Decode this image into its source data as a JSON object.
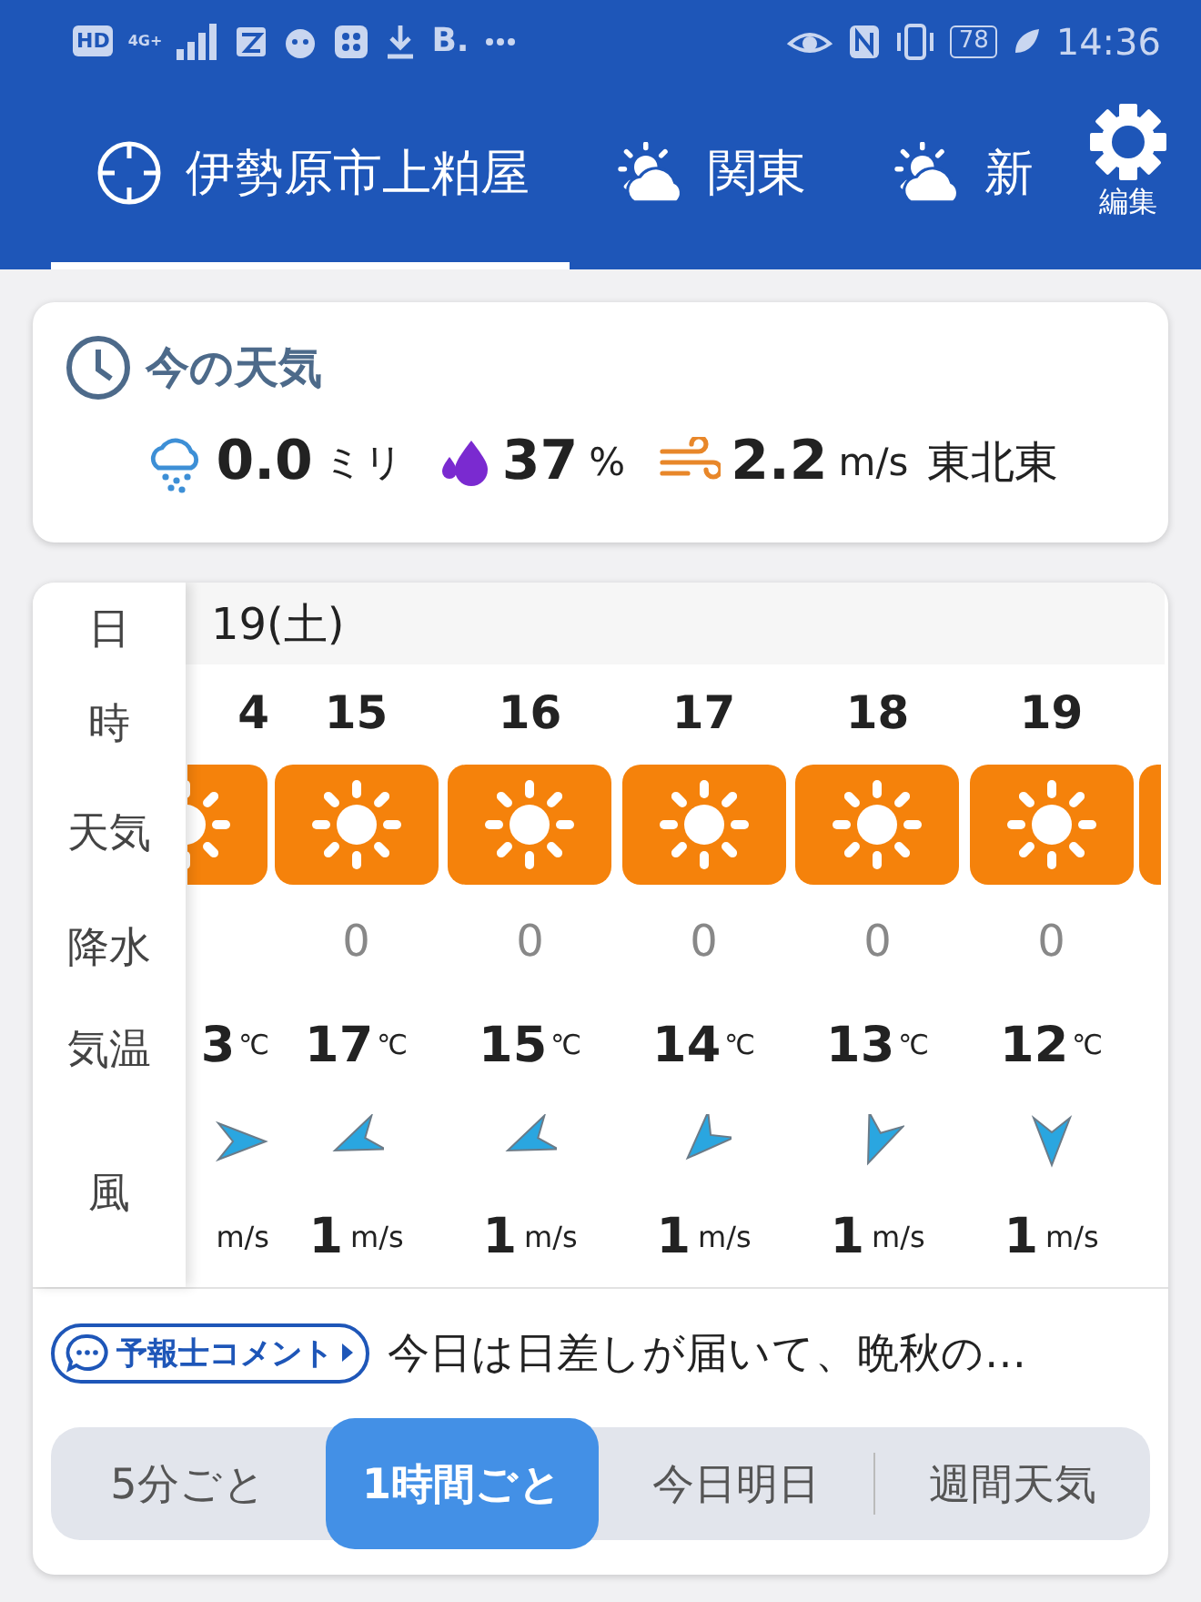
{
  "status_bar": {
    "hd": "HD",
    "network": "4G+",
    "app_letter": "B.",
    "battery": "78",
    "time": "14:36"
  },
  "tabs": [
    {
      "label": "伊勢原市上粕屋",
      "selected": true,
      "kind": "location"
    },
    {
      "label": "関東",
      "selected": false,
      "kind": "region"
    },
    {
      "label": "新",
      "selected": false,
      "kind": "region"
    }
  ],
  "edit_button": {
    "label": "編集"
  },
  "now": {
    "title": "今の天気",
    "rain": {
      "value": "0.0",
      "unit": "ミリ"
    },
    "humidity": {
      "value": "37",
      "unit": "%"
    },
    "wind": {
      "value": "2.2",
      "unit": "m/s",
      "direction": "東北東"
    }
  },
  "forecast": {
    "labels": {
      "date": "日",
      "hour": "時",
      "weather": "天気",
      "precip": "降水",
      "temp": "気温",
      "wind": "風"
    },
    "date": "19(土)",
    "columns": [
      {
        "kind": "partial-left",
        "hour": "4",
        "weather": {
          "kind": "sunny"
        },
        "temp": "3",
        "temp_unit": "℃",
        "wind_arrow": {
          "kind": "E"
        },
        "speed_unit": "m/s"
      },
      {
        "kind": "full",
        "hour": "15",
        "weather": {
          "kind": "sunny"
        },
        "precip": "0",
        "temp": "17",
        "temp_unit": "℃",
        "wind_arrow": {
          "kind": "WSW"
        },
        "speed": "1",
        "speed_unit": "m/s"
      },
      {
        "kind": "full",
        "hour": "16",
        "weather": {
          "kind": "sunny"
        },
        "precip": "0",
        "temp": "15",
        "temp_unit": "℃",
        "wind_arrow": {
          "kind": "WSW"
        },
        "speed": "1",
        "speed_unit": "m/s"
      },
      {
        "kind": "full",
        "hour": "17",
        "weather": {
          "kind": "sunny"
        },
        "precip": "0",
        "temp": "14",
        "temp_unit": "℃",
        "wind_arrow": {
          "kind": "SW"
        },
        "speed": "1",
        "speed_unit": "m/s"
      },
      {
        "kind": "full",
        "hour": "18",
        "weather": {
          "kind": "sunny"
        },
        "precip": "0",
        "temp": "13",
        "temp_unit": "℃",
        "wind_arrow": {
          "kind": "SSW"
        },
        "speed": "1",
        "speed_unit": "m/s"
      },
      {
        "kind": "full",
        "hour": "19",
        "weather": {
          "kind": "sunny"
        },
        "precip": "0",
        "temp": "12",
        "temp_unit": "℃",
        "wind_arrow": {
          "kind": "S"
        },
        "speed": "1",
        "speed_unit": "m/s"
      },
      {
        "kind": "partial-right",
        "weather": {
          "kind": "sunny"
        }
      }
    ]
  },
  "comment": {
    "button": "予報士コメント",
    "text": "今日は日差しが届いて、晩秋の…"
  },
  "modes": [
    {
      "label": "5分ごと",
      "selected": false
    },
    {
      "label": "1時間ごと",
      "selected": true
    },
    {
      "label": "今日明日",
      "selected": false
    },
    {
      "label": "週間天気",
      "selected": false
    }
  ]
}
